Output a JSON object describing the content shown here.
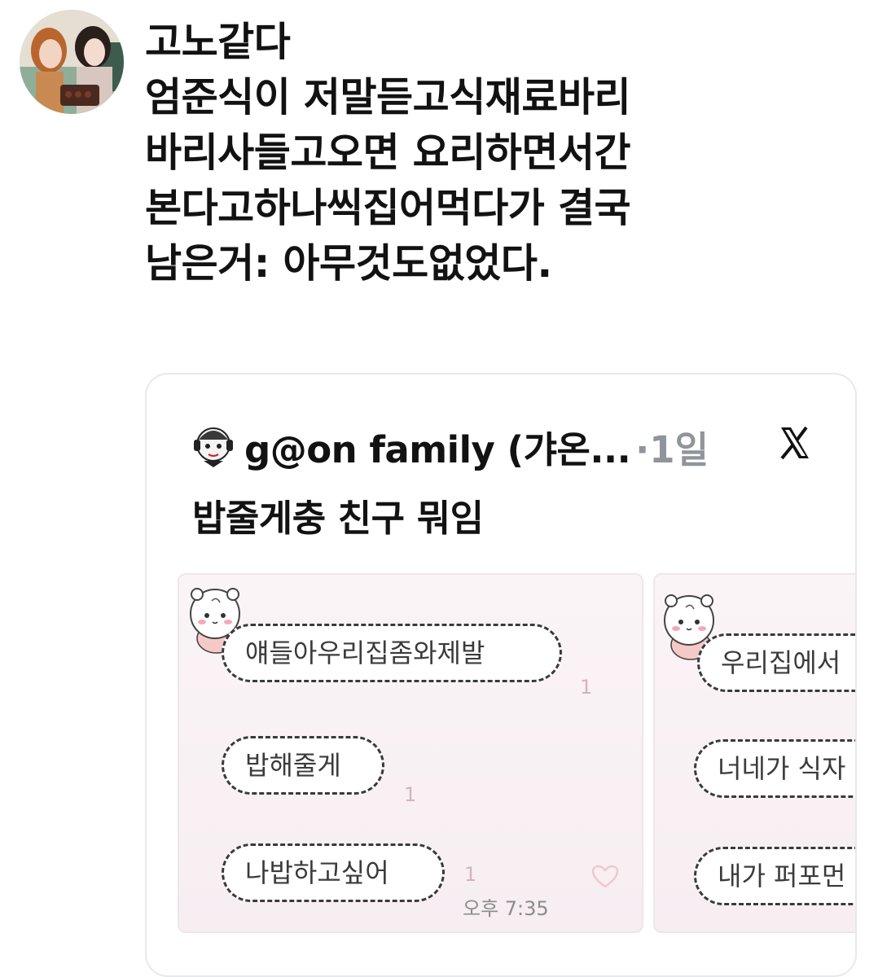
{
  "post": {
    "lines": [
      "고노같다",
      "엄준식이 저말듣고식재료바리",
      "바리사들고오면 요리하면서간",
      "본다고하나씩집어먹다가 결국",
      "남은거: 아무것도없었다."
    ]
  },
  "quote": {
    "author_name": "g@on family (갸온...",
    "time": "·1일",
    "text": "밥줄게충 친구 뭐임",
    "platform_icon": "x-logo-icon"
  },
  "chat_left": {
    "messages": [
      {
        "text": "얘들아우리집좀와제발",
        "read": "1"
      },
      {
        "text": "밥해줄게",
        "read": "1"
      },
      {
        "text": "나밥하고싶어",
        "read": "1"
      }
    ],
    "timestamp": "오후 7:35"
  },
  "chat_right": {
    "messages": [
      {
        "text": "우리집에서"
      },
      {
        "text": "너네가 식자"
      },
      {
        "text": "내가 퍼포먼"
      }
    ]
  },
  "colors": {
    "text": "#121212",
    "muted": "#8f959b",
    "card_border": "#e7e9ec",
    "chat_bg": "#f8f0f3"
  }
}
